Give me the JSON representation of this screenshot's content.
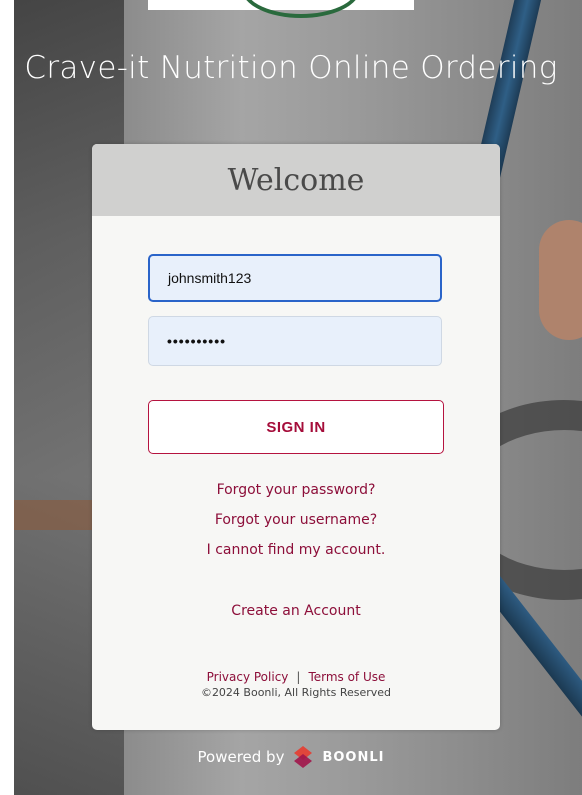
{
  "page": {
    "title": "Crave-it Nutrition Online Ordering"
  },
  "login": {
    "heading": "Welcome",
    "username_value": "johnsmith123",
    "password_value": "••••••••••",
    "signin_label": "SIGN IN",
    "forgot_password": "Forgot your password?",
    "forgot_username": "Forgot your username?",
    "cannot_find": "I cannot find my account.",
    "create_account": "Create an Account"
  },
  "footer": {
    "privacy": "Privacy Policy",
    "separator": "|",
    "terms": "Terms of Use",
    "copyright": "©2024 Boonli, All Rights Reserved"
  },
  "powered": {
    "text": "Powered by",
    "brand": "BOONLI",
    "logo_colors": [
      "#e0463b",
      "#a1154a"
    ]
  },
  "colors": {
    "accent": "#8d0f3a",
    "focus_border": "#2a64c9",
    "input_bg": "#e8f0fb"
  }
}
